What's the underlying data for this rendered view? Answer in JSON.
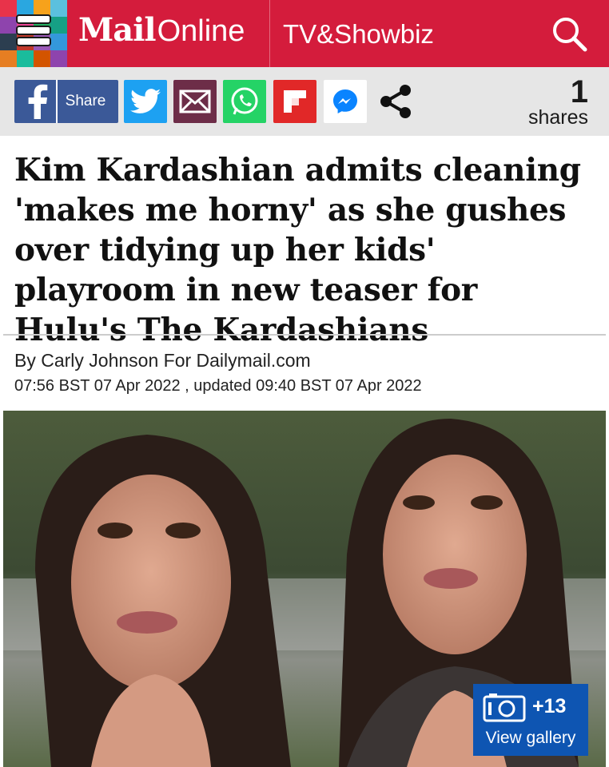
{
  "header": {
    "logo_mail": "Mail",
    "logo_online": "Online",
    "section": "TV&Showbiz",
    "brand_color": "#d41c3c"
  },
  "sharebar": {
    "facebook_label": "Share",
    "share_count": "1",
    "share_count_label": "shares",
    "icons": [
      "facebook-icon",
      "twitter-icon",
      "email-icon",
      "whatsapp-icon",
      "flipboard-icon",
      "messenger-icon",
      "share-icon"
    ]
  },
  "article": {
    "headline": "Kim Kardashian admits cleaning 'makes me horny' as she gushes over tidying up her kids' playroom in new teaser for Hulu's The Kardashians",
    "byline": "By Carly Johnson For Dailymail.com",
    "dates": "07:56 BST 07 Apr 2022 , updated 09:40 BST 07 Apr 2022"
  },
  "gallery": {
    "count": "+13",
    "label": "View gallery",
    "color": "#0e55b2"
  }
}
